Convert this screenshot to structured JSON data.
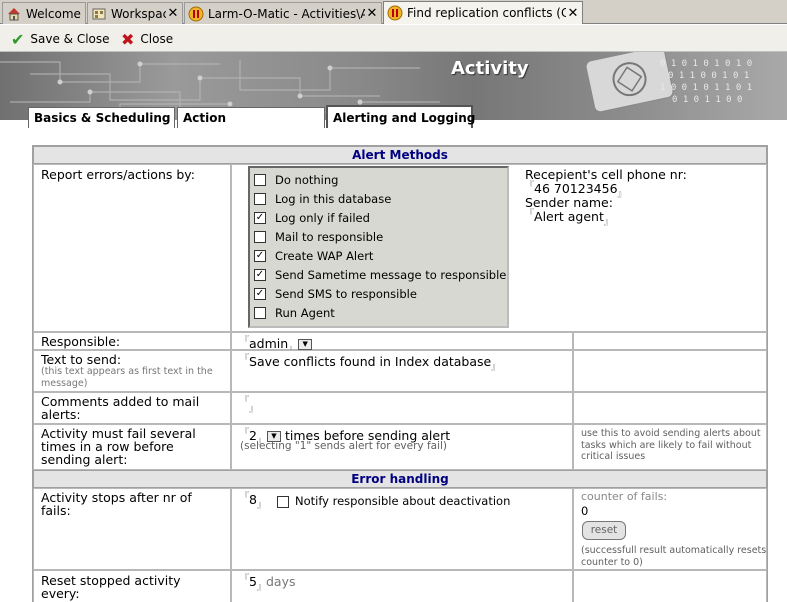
{
  "window_tabs": [
    {
      "label": "Welcome",
      "icon": "home-icon"
    },
    {
      "label": "Workspace",
      "icon": "workspace-icon"
    },
    {
      "label": "Larm-O-Matic - Activities\\Active...",
      "icon": "database-icon"
    },
    {
      "label": "Find replication conflicts (Check...",
      "icon": "database-icon"
    }
  ],
  "toolbar": {
    "save_close_label": "Save & Close",
    "close_label": "Close"
  },
  "banner": {
    "title": "Activity"
  },
  "doc_tabs": [
    "Basics & Scheduling",
    "Action",
    "Alerting and Logging"
  ],
  "alert_methods": {
    "header": "Alert Methods",
    "report_label": "Report errors/actions by:",
    "options": [
      {
        "label": "Do nothing",
        "checked": false
      },
      {
        "label": "Log in this database",
        "checked": false
      },
      {
        "label": "Log only if failed",
        "checked": true
      },
      {
        "label": "Mail to responsible",
        "checked": false
      },
      {
        "label": "Create WAP Alert",
        "checked": true
      },
      {
        "label": "Send Sametime message to responsible",
        "checked": true
      },
      {
        "label": "Send SMS to responsible",
        "checked": true
      },
      {
        "label": "Run Agent",
        "checked": false
      }
    ],
    "cell_label": "Recepient's cell phone nr:",
    "cell_value": "46 70123456",
    "sender_label": "Sender name:",
    "sender_value": "Alert agent"
  },
  "responsible": {
    "label": "Responsible:",
    "value": "admin"
  },
  "text_to_send": {
    "label": "Text to send:",
    "hint": "(this text appears as first text in the message)",
    "value": "Save conflicts found in Index database"
  },
  "comments": {
    "label": "Comments added to mail alerts:",
    "value": ""
  },
  "fail_times": {
    "label": "Activity must fail several times in a row before sending alert:",
    "value": "2",
    "suffix": "times before sending alert",
    "subtext": "(selecting \"1\" sends alert for every fail)",
    "hint": "use this to avoid sending alerts about tasks which are likely to fail without critical issues"
  },
  "error_handling": {
    "header": "Error handling",
    "stops_label": "Activity stops after nr of fails:",
    "stops_value": "8",
    "notify_label": "Notify responsible about deactivation",
    "notify_checked": false,
    "counter_label": "counter of fails:",
    "counter_value": "0",
    "reset_label": "reset",
    "reset_hint": "(successfull result automatically resets counter to 0)",
    "reset_every_label": "Reset stopped activity every:",
    "reset_every_value": "5",
    "reset_every_unit": "days"
  }
}
